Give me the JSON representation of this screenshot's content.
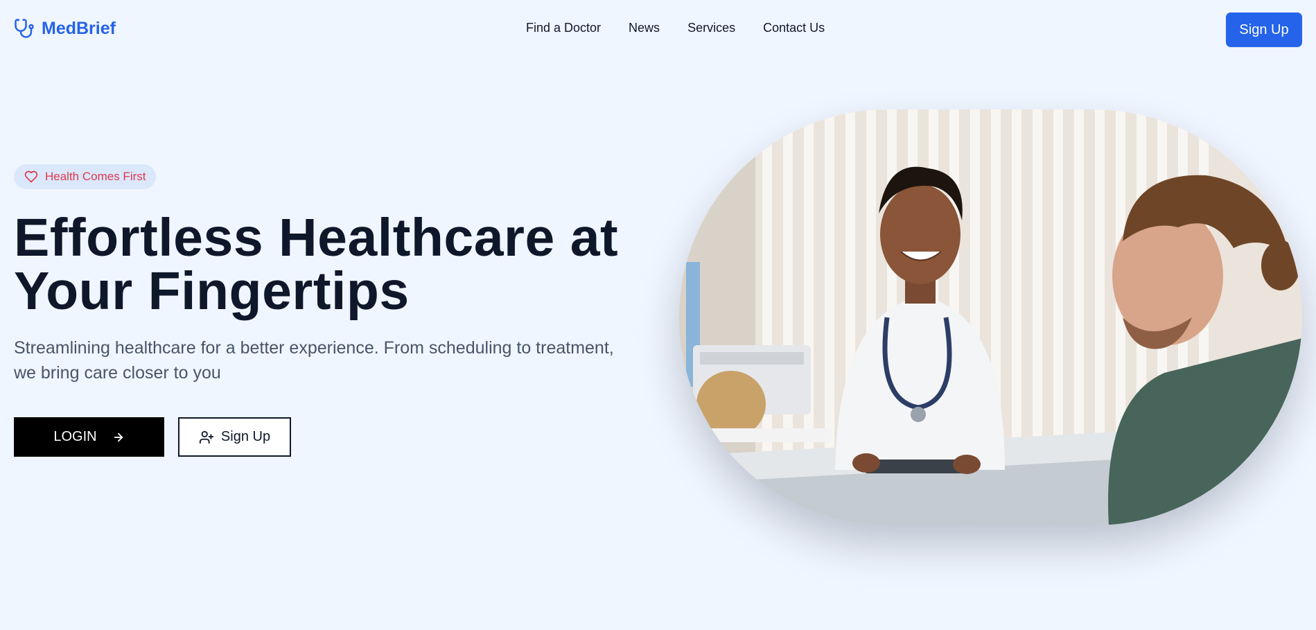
{
  "brand": {
    "name": "MedBrief",
    "icon": "stethoscope-icon",
    "color": "#2563eb"
  },
  "nav": {
    "links": [
      "Find a Doctor",
      "News",
      "Services",
      "Contact Us"
    ],
    "signup_label": "Sign Up"
  },
  "hero": {
    "badge": {
      "label": "Health Comes First",
      "icon": "heart-icon",
      "color": "#e0394c"
    },
    "title_line1": "Effortless Healthcare at",
    "title_line2": "Your Fingertips",
    "subtitle": "Streamlining healthcare for a better experience. From scheduling to treatment, we bring care closer to you",
    "login_label": "LOGIN",
    "login_icon": "arrow-right-icon",
    "signup_label": "Sign Up",
    "signup_icon": "user-plus-icon",
    "image": {
      "icon": "doctor-consultation-photo"
    }
  },
  "colors": {
    "background": "#f0f6ff",
    "accent": "#2563eb",
    "text": "#0f172a",
    "muted": "#475569"
  }
}
